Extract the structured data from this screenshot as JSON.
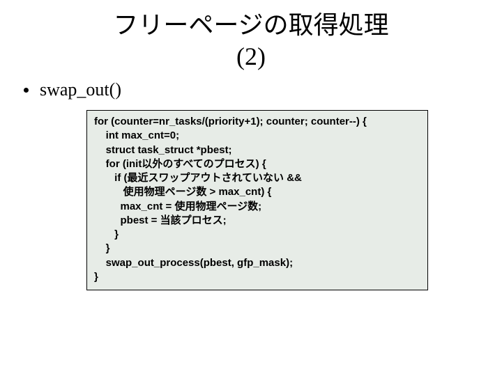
{
  "title_line1": "フリーページの取得処理",
  "title_line2": "(2)",
  "bullet": "swap_out()",
  "code": {
    "l1": "for (counter=nr_tasks/(priority+1); counter; counter--) {",
    "l2": "    int max_cnt=0;",
    "l3": "    struct task_struct *pbest;",
    "l4": "    for (init以外のすべてのプロセス) {",
    "l5": "       if (最近スワップアウトされていない &&",
    "l6": "          使用物理ページ数 > max_cnt) {",
    "l7": "         max_cnt = 使用物理ページ数;",
    "l8": "         pbest = 当該プロセス;",
    "l9": "       }",
    "l10": "    }",
    "l11": "    swap_out_process(pbest, gfp_mask);",
    "l12": "}"
  }
}
